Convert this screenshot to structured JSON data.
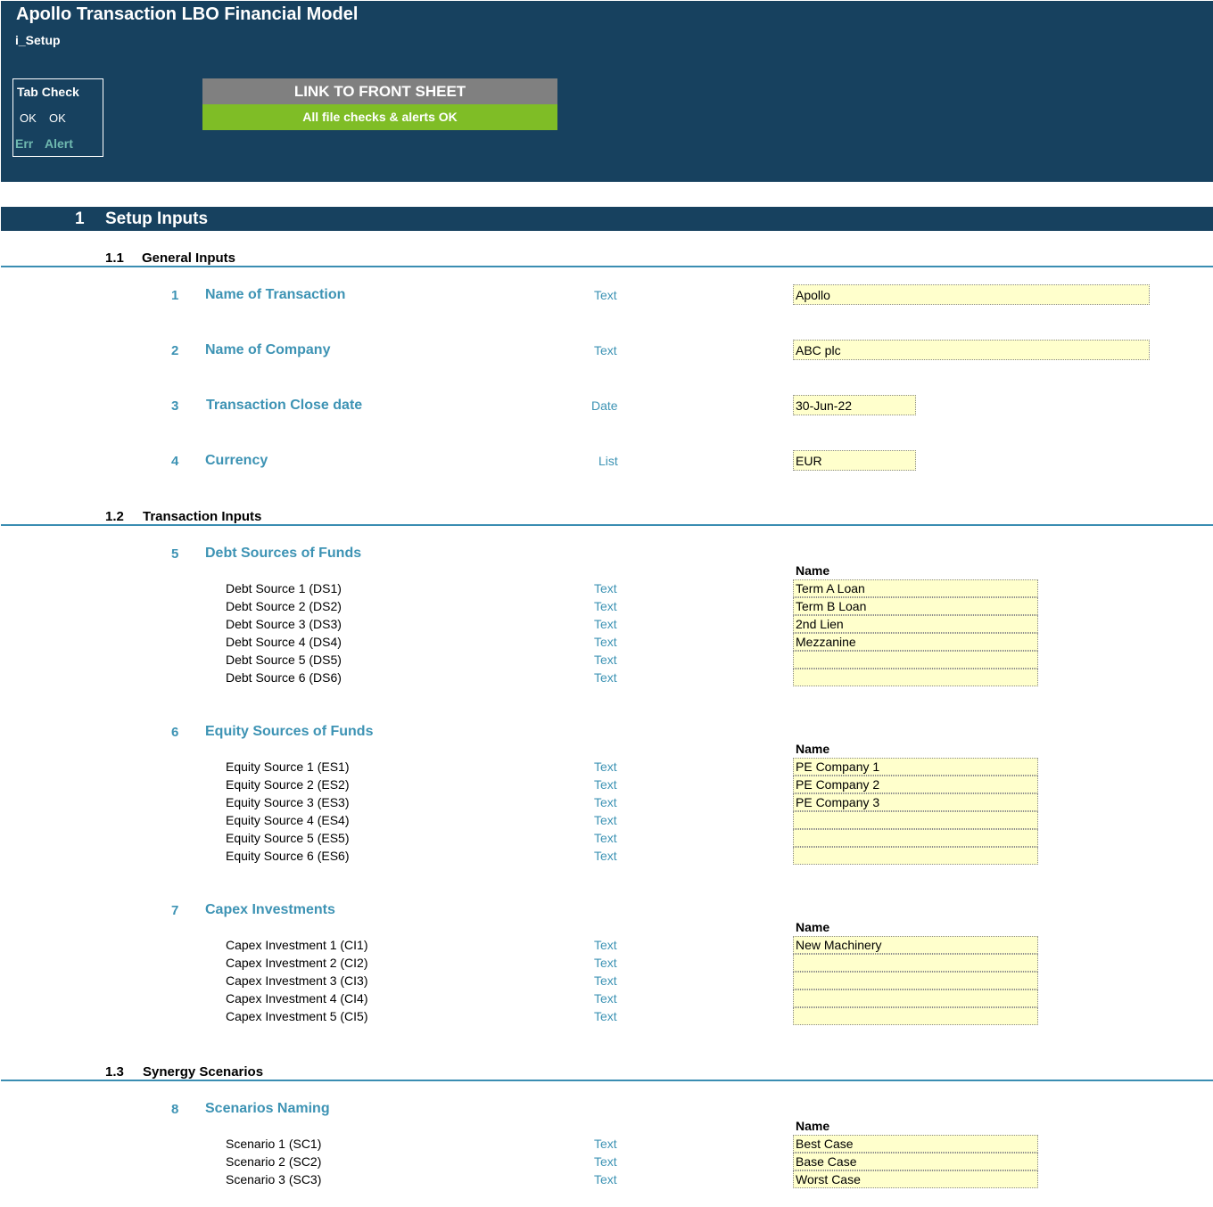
{
  "header": {
    "title": "Apollo Transaction LBO Financial Model",
    "sheet": "i_Setup",
    "tab_check": {
      "title": "Tab Check",
      "ok1": "OK",
      "ok2": "OK",
      "err": "Err",
      "alert": "Alert"
    },
    "link_button": "LINK TO FRONT SHEET",
    "checks_status": "All file checks & alerts OK",
    "colors": {
      "banner": "#17415f",
      "checks_ok": "#7fbd26",
      "link_button": "#808080",
      "accent": "#3d93b4",
      "input_fill": "#ffffcc"
    }
  },
  "section": {
    "number": "1",
    "title": "Setup Inputs"
  },
  "subsections": [
    {
      "number": "1.1",
      "title": "General Inputs"
    },
    {
      "number": "1.2",
      "title": "Transaction Inputs"
    },
    {
      "number": "1.3",
      "title": "Synergy Scenarios"
    }
  ],
  "general": [
    {
      "num": "1",
      "label": "Name of Transaction",
      "type": "Text",
      "value": "Apollo"
    },
    {
      "num": "2",
      "label": "Name of Company",
      "type": "Text",
      "value": "ABC plc"
    },
    {
      "num": "3",
      "label": "Transaction Close date",
      "type": "Date",
      "value": "30-Jun-22"
    },
    {
      "num": "4",
      "label": "Currency",
      "type": "List",
      "value": "EUR"
    }
  ],
  "groups": [
    {
      "num": "5",
      "title": "Debt Sources of Funds",
      "name_header": "Name",
      "rows": [
        {
          "label": "Debt Source 1 (DS1)",
          "type": "Text",
          "value": "Term A Loan"
        },
        {
          "label": "Debt Source 2 (DS2)",
          "type": "Text",
          "value": "Term B Loan"
        },
        {
          "label": "Debt Source 3 (DS3)",
          "type": "Text",
          "value": "2nd Lien"
        },
        {
          "label": "Debt Source 4 (DS4)",
          "type": "Text",
          "value": "Mezzanine"
        },
        {
          "label": "Debt Source 5 (DS5)",
          "type": "Text",
          "value": ""
        },
        {
          "label": "Debt Source 6 (DS6)",
          "type": "Text",
          "value": ""
        }
      ]
    },
    {
      "num": "6",
      "title": "Equity Sources of Funds",
      "name_header": "Name",
      "rows": [
        {
          "label": "Equity Source 1 (ES1)",
          "type": "Text",
          "value": "PE Company 1"
        },
        {
          "label": "Equity Source 2 (ES2)",
          "type": "Text",
          "value": "PE Company 2"
        },
        {
          "label": "Equity Source 3 (ES3)",
          "type": "Text",
          "value": "PE Company 3"
        },
        {
          "label": "Equity Source 4 (ES4)",
          "type": "Text",
          "value": ""
        },
        {
          "label": "Equity Source 5 (ES5)",
          "type": "Text",
          "value": ""
        },
        {
          "label": "Equity Source 6 (ES6)",
          "type": "Text",
          "value": ""
        }
      ]
    },
    {
      "num": "7",
      "title": "Capex Investments",
      "name_header": "Name",
      "rows": [
        {
          "label": "Capex Investment 1 (CI1)",
          "type": "Text",
          "value": "New Machinery"
        },
        {
          "label": "Capex Investment 2 (CI2)",
          "type": "Text",
          "value": ""
        },
        {
          "label": "Capex Investment 3 (CI3)",
          "type": "Text",
          "value": ""
        },
        {
          "label": "Capex Investment 4 (CI4)",
          "type": "Text",
          "value": ""
        },
        {
          "label": "Capex Investment 5 (CI5)",
          "type": "Text",
          "value": ""
        }
      ]
    },
    {
      "num": "8",
      "title": "Scenarios Naming",
      "name_header": "Name",
      "rows": [
        {
          "label": "Scenario 1 (SC1)",
          "type": "Text",
          "value": "Best Case"
        },
        {
          "label": "Scenario 2 (SC2)",
          "type": "Text",
          "value": "Base Case"
        },
        {
          "label": "Scenario 3 (SC3)",
          "type": "Text",
          "value": "Worst Case"
        }
      ]
    }
  ]
}
